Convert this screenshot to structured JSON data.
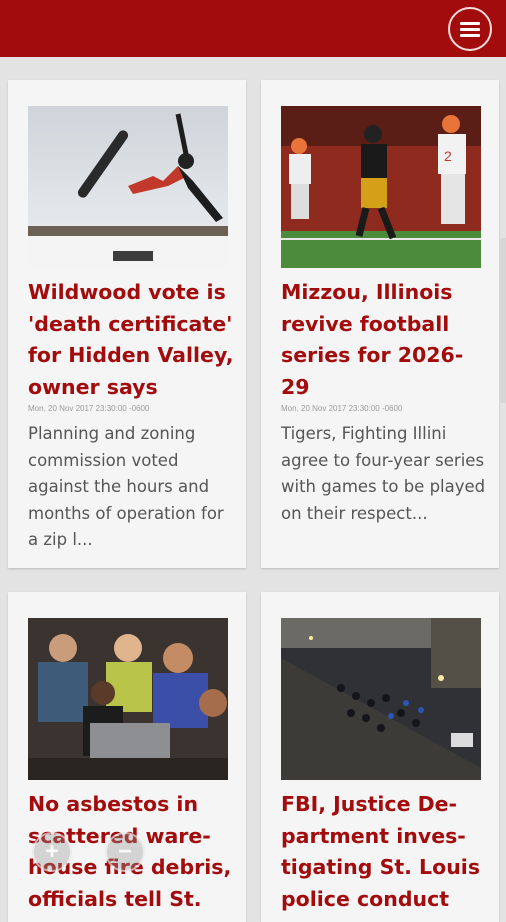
{
  "app": {
    "accent_color": "#a30c0c",
    "menu_icon": "hamburger-menu-icon"
  },
  "articles": [
    {
      "title": "Wildwood vote is 'death certificate' for Hidden Valley, owner says",
      "date": "Mon, 20 Nov 2017 23:30:00 -0600",
      "summary": "Planning and zoning commission voted against the hours and months of operation for a zip l...",
      "image": "snowboarder-photo"
    },
    {
      "title": "Mizzou, Illinois revive football series for 2026-29",
      "date": "Mon, 20 Nov 2017 23:30:00 -0600",
      "summary": "Tigers, Fighting Illini agree to four-year series with games to be played on their respect...",
      "image": "football-game-photo"
    },
    {
      "title": "No asbestos in scattered ware-house fire debris, officials tell St.",
      "date": "",
      "summary": "",
      "image": "meeting-crowd-photo"
    },
    {
      "title": "FBI, Justice De-partment inves-tigating St. Louis police conduct",
      "date": "",
      "summary": "",
      "image": "protest-aerial-photo"
    }
  ],
  "zoom_controls": {
    "zoom_in": "+",
    "zoom_out": "−"
  }
}
